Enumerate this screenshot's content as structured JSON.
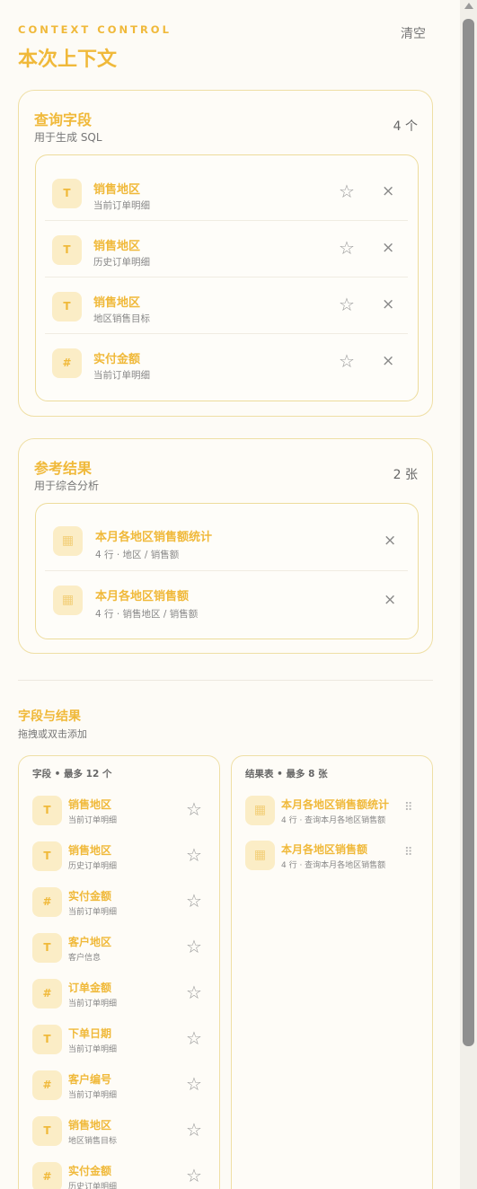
{
  "header": {
    "eyebrow": "CONTEXT CONTROL",
    "title": "本次上下文",
    "clear_label": "清空"
  },
  "query_fields": {
    "title": "查询字段",
    "subtitle": "用于生成 SQL",
    "count": "4 个",
    "items": [
      {
        "type_icon": "T",
        "name": "销售地区",
        "source": "当前订单明细"
      },
      {
        "type_icon": "T",
        "name": "销售地区",
        "source": "历史订单明细"
      },
      {
        "type_icon": "T",
        "name": "销售地区",
        "source": "地区销售目标"
      },
      {
        "type_icon": "#",
        "name": "实付金额",
        "source": "当前订单明细"
      }
    ],
    "star_glyph": "☆",
    "remove_glyph": "×"
  },
  "reference_results": {
    "title": "参考结果",
    "subtitle": "用于综合分析",
    "count": "2 张",
    "items": [
      {
        "name": "本月各地区销售额统计",
        "meta": "4 行 · 地区 / 销售额"
      },
      {
        "name": "本月各地区销售额",
        "meta": "4 行 · 销售地区 / 销售额"
      }
    ],
    "table_icon_glyph": "▦",
    "remove_glyph": "×"
  },
  "library": {
    "title": "字段与结果",
    "subtitle": "拖拽或双击添加",
    "fields_header": "字段 • 最多 12 个",
    "tables_header": "结果表 • 最多 8 张",
    "fields": [
      {
        "type_icon": "T",
        "name": "销售地区",
        "source": "当前订单明细"
      },
      {
        "type_icon": "T",
        "name": "销售地区",
        "source": "历史订单明细"
      },
      {
        "type_icon": "#",
        "name": "实付金额",
        "source": "当前订单明细"
      },
      {
        "type_icon": "T",
        "name": "客户地区",
        "source": "客户信息"
      },
      {
        "type_icon": "#",
        "name": "订单金额",
        "source": "当前订单明细"
      },
      {
        "type_icon": "T",
        "name": "下单日期",
        "source": "当前订单明细"
      },
      {
        "type_icon": "#",
        "name": "客户编号",
        "source": "当前订单明细"
      },
      {
        "type_icon": "T",
        "name": "销售地区",
        "source": "地区销售目标"
      },
      {
        "type_icon": "#",
        "name": "实付金额",
        "source": "历史订单明细"
      }
    ],
    "tables": [
      {
        "name": "本月各地区销售额统计",
        "meta": "4 行 · 查询本月各地区销售额"
      },
      {
        "name": "本月各地区销售额",
        "meta": "4 行 · 查询本月各地区销售额"
      }
    ],
    "star_glyph": "☆",
    "drag_glyph": "⠿"
  },
  "colors": {
    "accent": "#f0b93a",
    "icon_bg": "#fbedc6",
    "border": "#efdfa5",
    "background": "#fdfbf6"
  }
}
